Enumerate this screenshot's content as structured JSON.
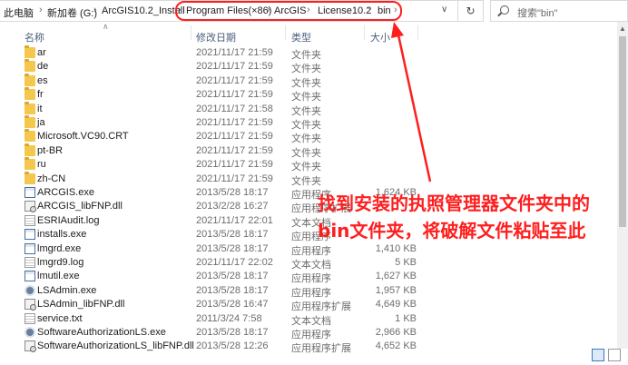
{
  "breadcrumb": {
    "items": [
      "此电脑",
      "新加卷 (G:)",
      "ArcGIS10.2_Install",
      "Program Files(×86)",
      "ArcGIS",
      "License10.2",
      "bin"
    ]
  },
  "search": {
    "placeholder": "搜索\"bin\""
  },
  "columns": {
    "name": "名称",
    "date": "修改日期",
    "type": "类型",
    "size": "大小"
  },
  "files": [
    {
      "name": "ar",
      "date": "2021/11/17 21:59",
      "type": "文件夹",
      "size": "",
      "icon": "folder"
    },
    {
      "name": "de",
      "date": "2021/11/17 21:59",
      "type": "文件夹",
      "size": "",
      "icon": "folder"
    },
    {
      "name": "es",
      "date": "2021/11/17 21:59",
      "type": "文件夹",
      "size": "",
      "icon": "folder"
    },
    {
      "name": "fr",
      "date": "2021/11/17 21:59",
      "type": "文件夹",
      "size": "",
      "icon": "folder"
    },
    {
      "name": "it",
      "date": "2021/11/17 21:58",
      "type": "文件夹",
      "size": "",
      "icon": "folder"
    },
    {
      "name": "ja",
      "date": "2021/11/17 21:59",
      "type": "文件夹",
      "size": "",
      "icon": "folder"
    },
    {
      "name": "Microsoft.VC90.CRT",
      "date": "2021/11/17 21:59",
      "type": "文件夹",
      "size": "",
      "icon": "folder"
    },
    {
      "name": "pt-BR",
      "date": "2021/11/17 21:59",
      "type": "文件夹",
      "size": "",
      "icon": "folder"
    },
    {
      "name": "ru",
      "date": "2021/11/17 21:59",
      "type": "文件夹",
      "size": "",
      "icon": "folder"
    },
    {
      "name": "zh-CN",
      "date": "2021/11/17 21:59",
      "type": "文件夹",
      "size": "",
      "icon": "folder"
    },
    {
      "name": "ARCGIS.exe",
      "date": "2013/5/28 18:17",
      "type": "应用程序",
      "size": "1,624 KB",
      "icon": "exe"
    },
    {
      "name": "ARCGIS_libFNP.dll",
      "date": "2013/2/28 16:27",
      "type": "应用程序扩展",
      "size": "",
      "icon": "dll"
    },
    {
      "name": "ESRIAudit.log",
      "date": "2021/11/17 22:01",
      "type": "文本文档",
      "size": "",
      "icon": "log"
    },
    {
      "name": "installs.exe",
      "date": "2013/5/28 18:17",
      "type": "应用程序",
      "size": "",
      "icon": "exe"
    },
    {
      "name": "lmgrd.exe",
      "date": "2013/5/28 18:17",
      "type": "应用程序",
      "size": "1,410 KB",
      "icon": "exe"
    },
    {
      "name": "lmgrd9.log",
      "date": "2021/11/17 22:02",
      "type": "文本文档",
      "size": "5 KB",
      "icon": "log"
    },
    {
      "name": "lmutil.exe",
      "date": "2013/5/28 18:17",
      "type": "应用程序",
      "size": "1,627 KB",
      "icon": "exe"
    },
    {
      "name": "LSAdmin.exe",
      "date": "2013/5/28 18:17",
      "type": "应用程序",
      "size": "1,957 KB",
      "icon": "gear"
    },
    {
      "name": "LSAdmin_libFNP.dll",
      "date": "2013/5/28 16:47",
      "type": "应用程序扩展",
      "size": "4,649 KB",
      "icon": "dll"
    },
    {
      "name": "service.txt",
      "date": "2011/3/24 7:58",
      "type": "文本文档",
      "size": "1 KB",
      "icon": "txt"
    },
    {
      "name": "SoftwareAuthorizationLS.exe",
      "date": "2013/5/28 18:17",
      "type": "应用程序",
      "size": "2,966 KB",
      "icon": "gear"
    },
    {
      "name": "SoftwareAuthorizationLS_libFNP.dll",
      "date": "2013/5/28 12:26",
      "type": "应用程序扩展",
      "size": "4,652 KB",
      "icon": "dll"
    }
  ],
  "annotation": {
    "line1": "找到安装的执照管理器文件夹中的",
    "line2": "bin文件夹，将破解文件粘贴至此",
    "color": "#ff1e1e"
  }
}
